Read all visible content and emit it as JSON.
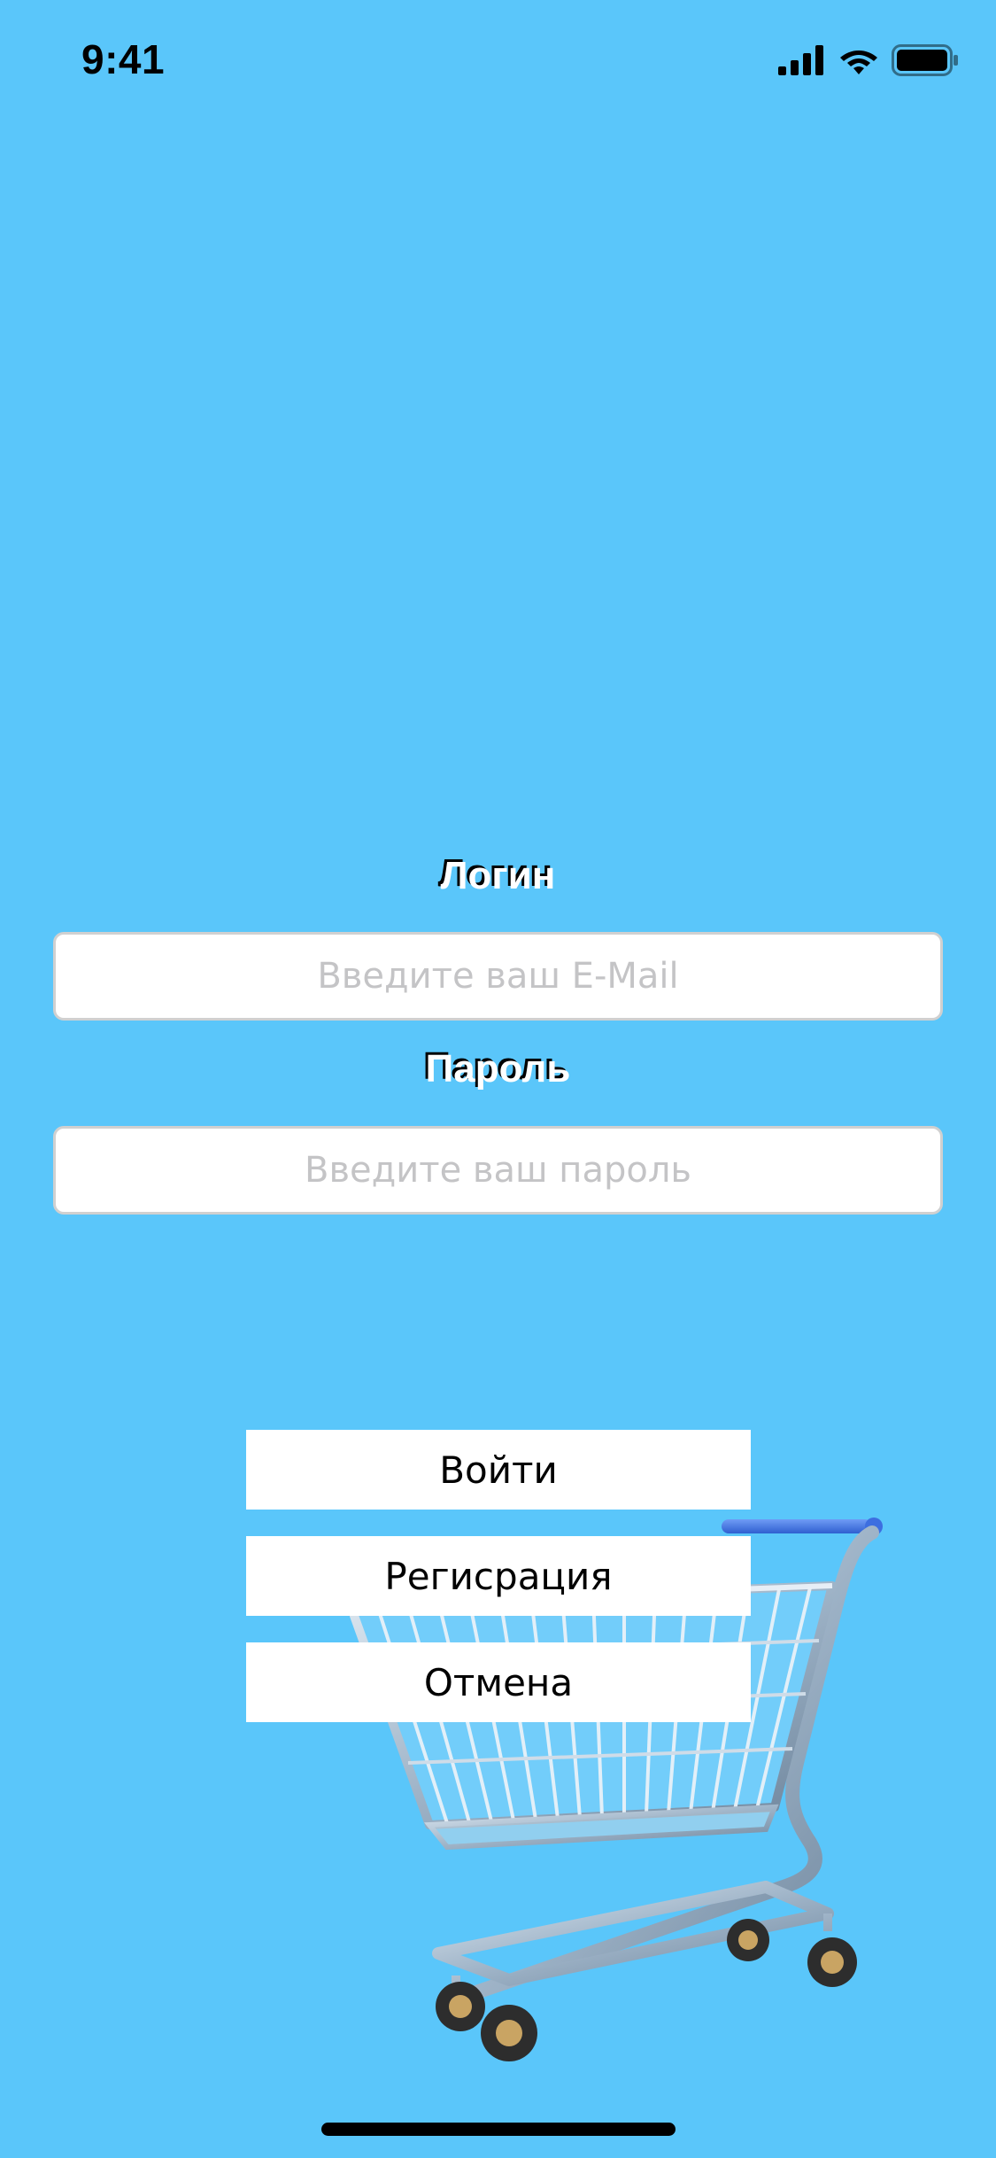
{
  "status_bar": {
    "time": "9:41",
    "icons": [
      "cellular-signal-icon",
      "wifi-icon",
      "battery-icon"
    ]
  },
  "form": {
    "login_label": "Логин",
    "email_placeholder": "Введите ваш E-Mail",
    "email_value": "",
    "password_label": "Пароль",
    "password_placeholder": "Введите ваш пароль",
    "password_value": ""
  },
  "buttons": {
    "login": "Войти",
    "register": "Регисрация",
    "cancel": "Отмена"
  },
  "illustration": {
    "name": "shopping-cart-icon"
  },
  "colors": {
    "background": "#5ac6fa",
    "button_background": "#ffffff",
    "label_text": "#ffffff",
    "placeholder": "#c4c4c6"
  }
}
